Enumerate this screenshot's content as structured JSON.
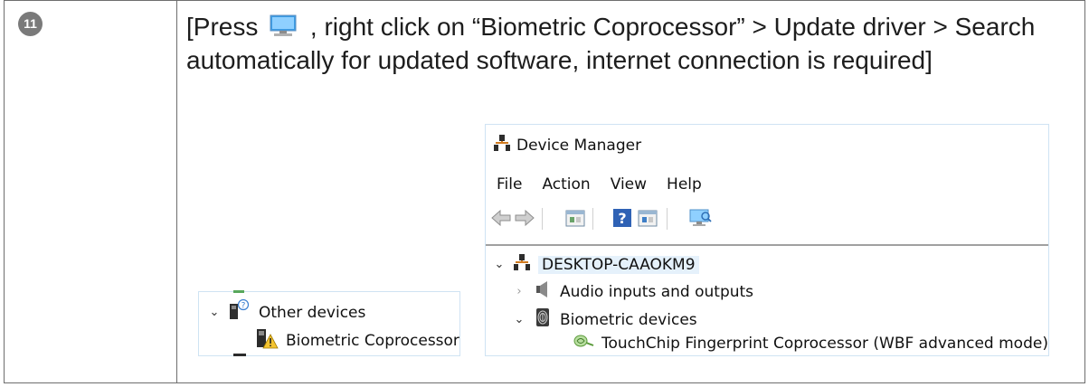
{
  "step": {
    "number": "11"
  },
  "instruction": {
    "part1": "[Press ",
    "part2": " , right click on “Biometric Coprocessor” > Update driver > Search automatically for updated software, internet connection is required]",
    "inline_icon": "computer-monitor-icon"
  },
  "other_devices_panel": {
    "group_label": "Other devices",
    "child_label": "Biometric Coprocessor",
    "icons": [
      "unknown-device-icon",
      "warning-device-icon"
    ]
  },
  "device_manager": {
    "title": "Device Manager",
    "menu": [
      "File",
      "Action",
      "View",
      "Help"
    ],
    "toolbar_icons": [
      "back-arrow-icon",
      "forward-arrow-icon",
      "properties-icon",
      "help-icon",
      "update-driver-icon",
      "scan-hardware-icon"
    ],
    "computer_name": "DESKTOP-CAAOKM9",
    "tree": {
      "audio": "Audio inputs and outputs",
      "biometric": "Biometric devices",
      "fingerprint": "TouchChip Fingerprint Coprocessor (WBF advanced mode)"
    }
  },
  "colors": {
    "badge": "#7a7a7a",
    "border": "#6e6e6e",
    "panel_border": "#cfe3f3"
  }
}
